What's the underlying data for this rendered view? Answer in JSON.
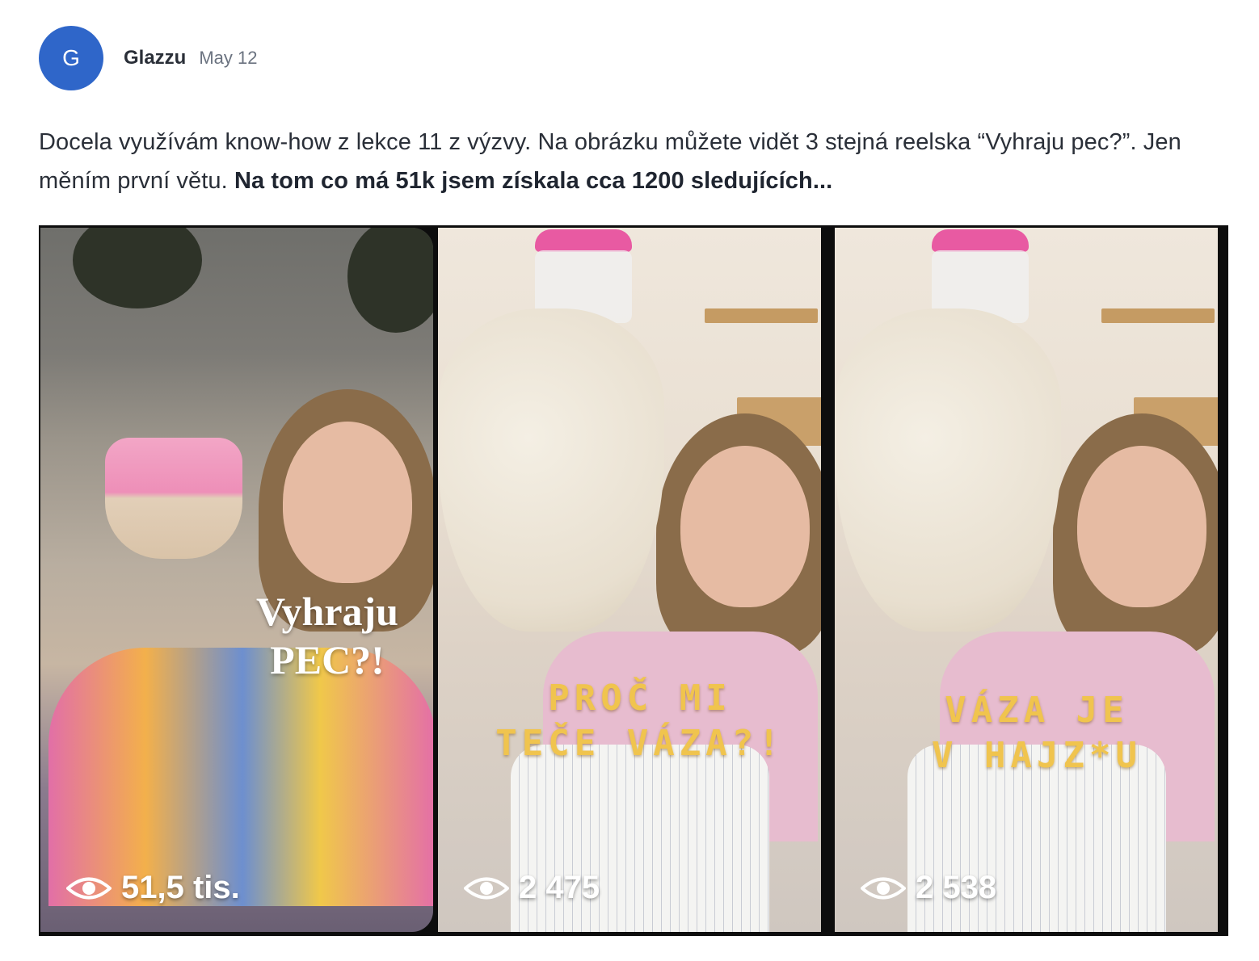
{
  "post": {
    "avatar_letter": "G",
    "author": "Glazzu",
    "date": "May 12",
    "text_plain": "Docela využívám know-how z lekce 11 z výzvy. Na obrázku můžete vidět 3 stejná reelska “Vyhraju pec?”. Jen měním první větu. ",
    "text_bold": "Na tom co má 51k jsem získala cca 1200 sledujících..."
  },
  "reels": [
    {
      "overlay_line1": "Vyhraju",
      "overlay_line2": "PEC?!",
      "views": "51,5 tis."
    },
    {
      "overlay_line1": "PROČ MI",
      "overlay_line2": "TEČE VÁZA?!",
      "views": "2 475"
    },
    {
      "overlay_line1": "VÁZA JE",
      "overlay_line2": "V HAJZ*U",
      "views": "2 538"
    }
  ],
  "icons": {
    "views": "eye-icon"
  },
  "colors": {
    "avatar": "#2f66c9",
    "overlay_yellow": "#f0c44e"
  }
}
